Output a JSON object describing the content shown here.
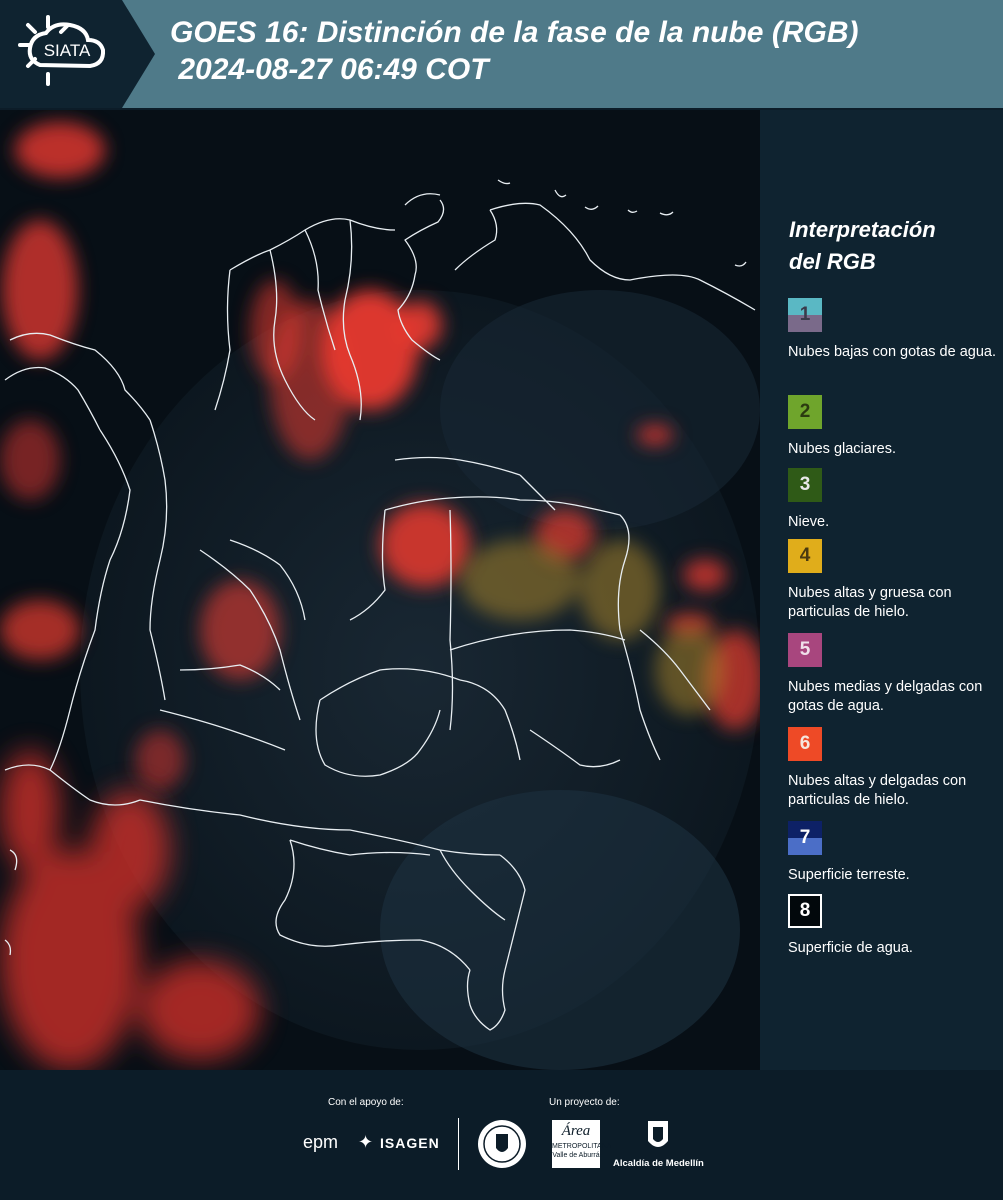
{
  "header": {
    "logo_text": "SIATA",
    "title_line1": "GOES 16: Distinción de la fase de la nube (RGB)",
    "title_line2": " 2024-08-27 06:49 COT"
  },
  "legend": {
    "title_line1": "Interpretación",
    "title_line2": "del RGB",
    "items": [
      {
        "number": "1",
        "text": "Nubes bajas con gotas de agua.",
        "color_top": "#5ab8c4",
        "color_bottom": "#7a6a8a"
      },
      {
        "number": "2",
        "text": "Nubes glaciares.",
        "color": "#6fa52c"
      },
      {
        "number": "3",
        "text": "Nieve.",
        "color": "#2f5a17"
      },
      {
        "number": "4",
        "text": "Nubes altas y gruesa con particulas de hielo.",
        "color": "#e0ad1b"
      },
      {
        "number": "5",
        "text": "Nubes medias y delgadas con gotas de agua.",
        "color": "#a8467e"
      },
      {
        "number": "6",
        "text": "Nubes altas y delgadas con particulas de hielo.",
        "color": "#ee4a26"
      },
      {
        "number": "7",
        "text": "Superficie terreste.",
        "color_top": "#0d2166",
        "color_bottom": "#4b6ec7"
      },
      {
        "number": "8",
        "text": "Superficie de agua.",
        "color": "#02080c"
      }
    ]
  },
  "footer": {
    "support_label": "Con el apoyo de:",
    "project_label": "Un proyecto de:",
    "logo_epm": "epm",
    "logo_isagen": "ISAGEN",
    "logo_area_name": "Área",
    "logo_area_sub": "METROPOLITANA",
    "logo_area_sub2": "Valle de Aburrá",
    "logo_alcaldia": "Alcaldía de Medellín"
  }
}
